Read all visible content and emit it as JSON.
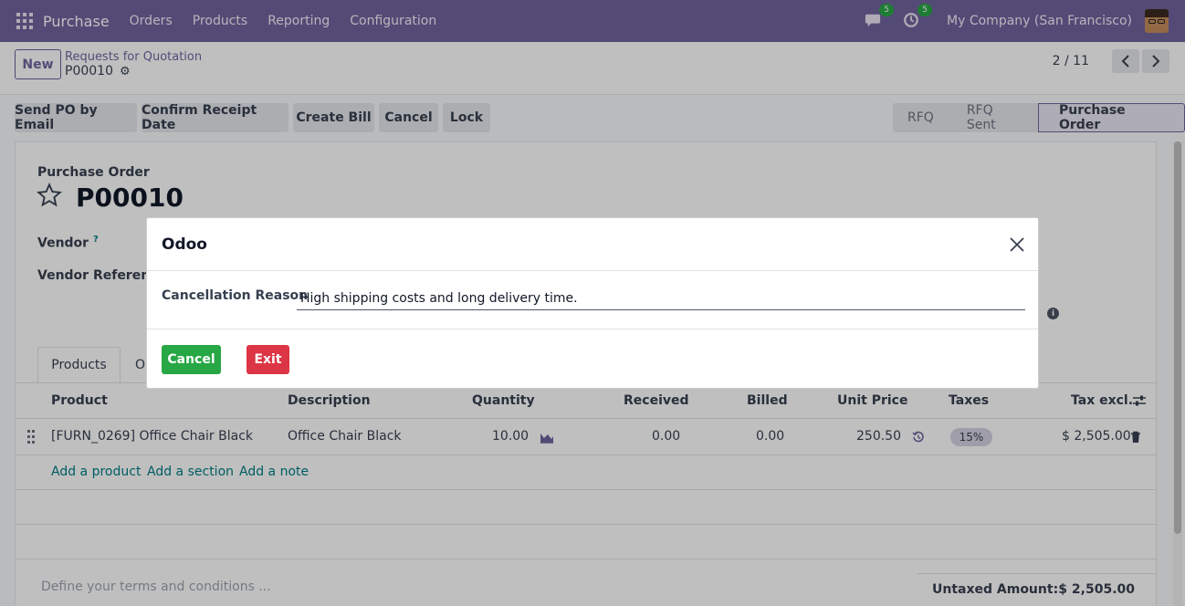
{
  "navbar": {
    "app_name": "Purchase",
    "menu": [
      "Orders",
      "Products",
      "Reporting",
      "Configuration"
    ],
    "messages_count": "5",
    "activities_count": "5",
    "company": "My Company (San Francisco)"
  },
  "control": {
    "new_label": "New",
    "breadcrumb": "Requests for Quotation",
    "record": "P00010",
    "pager": "2 / 11"
  },
  "actions": {
    "send_po": "Send PO by Email",
    "confirm_receipt": "Confirm Receipt Date",
    "create_bill": "Create Bill",
    "cancel": "Cancel",
    "lock": "Lock"
  },
  "statusbar": [
    "RFQ",
    "RFQ Sent",
    "Purchase Order"
  ],
  "form": {
    "type_label": "Purchase Order",
    "number": "P00010",
    "vendor_label": "Vendor",
    "vendor_help": "?",
    "vendor_ref_label": "Vendor Reference",
    "tabs": [
      "Products",
      "O"
    ]
  },
  "table": {
    "headers": [
      "Product",
      "Description",
      "Quantity",
      "Received",
      "Billed",
      "Unit Price",
      "Taxes",
      "Tax excl."
    ],
    "rows": [
      {
        "product": "[FURN_0269] Office Chair Black",
        "description": "Office Chair Black",
        "quantity": "10.00",
        "received": "0.00",
        "billed": "0.00",
        "unit_price": "250.50",
        "taxes": "15%",
        "subtotal": "$ 2,505.00"
      }
    ],
    "add_links": [
      "Add a product",
      "Add a section",
      "Add a note"
    ]
  },
  "footer": {
    "terms_placeholder": "Define your terms and conditions ...",
    "untaxed_label": "Untaxed Amount:",
    "untaxed_value": "$ 2,505.00"
  },
  "modal": {
    "title": "Odoo",
    "reason_label": "Cancellation Reason",
    "reason_value": "High shipping costs and long delivery time.",
    "cancel_label": "Cancel",
    "exit_label": "Exit"
  },
  "colors": {
    "navbar": "#71639e",
    "link": "#017e84",
    "success": "#28a745",
    "danger": "#dc3545"
  }
}
